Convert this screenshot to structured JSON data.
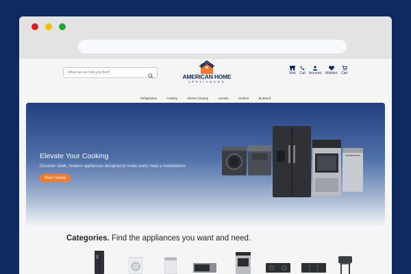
{
  "search": {
    "placeholder": "What can we help you find?"
  },
  "logo": {
    "line1": "AMERICAN HOME",
    "line2": "APPLIANCES"
  },
  "actions": [
    {
      "label": "Visit",
      "icon": "store-icon"
    },
    {
      "label": "Call",
      "icon": "phone-icon"
    },
    {
      "label": "Account",
      "icon": "user-icon"
    },
    {
      "label": "Wishlist",
      "icon": "heart-icon"
    },
    {
      "label": "Cart",
      "icon": "cart-icon"
    }
  ],
  "nav": [
    "Refrigeration",
    "Cooking",
    "Kitchen Cleanup",
    "Laundry",
    "Outdoor",
    "By Brand"
  ],
  "hero": {
    "title": "Elevate Your Cooking",
    "subtitle": "Discover sleek, modern appliances designed to make every meal a masterpiece.",
    "cta": "Shop Cooking",
    "slides": 4
  },
  "categories": {
    "bold": "Categories.",
    "rest": " Find the appliances you want and need."
  },
  "colors": {
    "navy": "#0f2a5f",
    "accent": "#f27c2a",
    "page": "#f5f5f5"
  }
}
